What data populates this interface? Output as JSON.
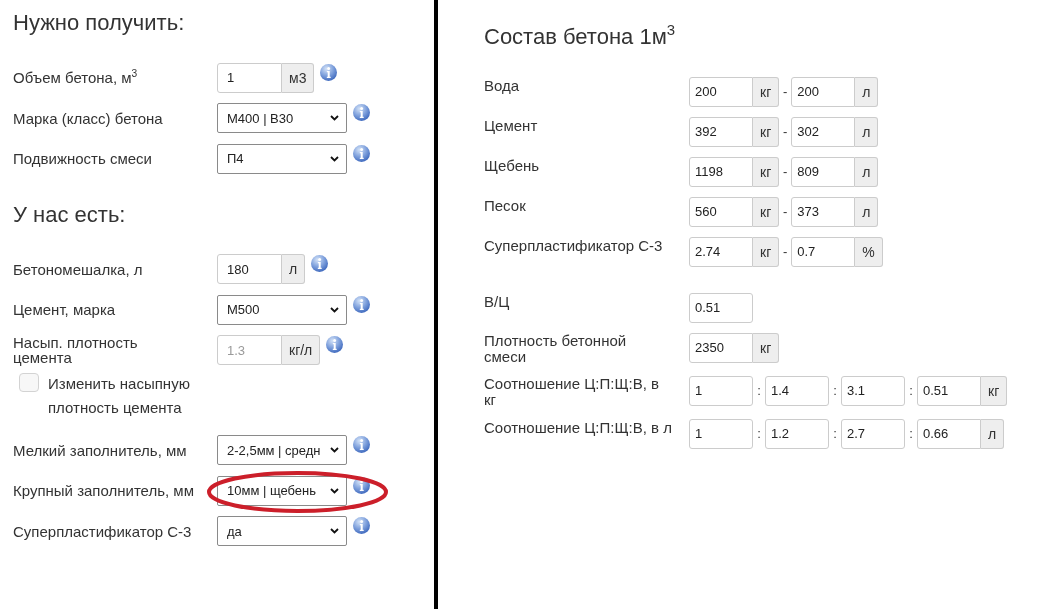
{
  "required": {
    "title": "Нужно получить:",
    "fields": [
      {
        "kind": "input",
        "label": "Объем бетона, м$^{3}$",
        "value": "1",
        "unit": "м3",
        "disabled": false,
        "highlighted": false
      },
      {
        "kind": "select",
        "label": "Марка (класс) бетона",
        "value": "М400 | В30",
        "disabled": false,
        "highlighted": false
      },
      {
        "kind": "select",
        "label": "Подвижность смеси",
        "value": "П4",
        "disabled": false,
        "highlighted": false
      }
    ]
  },
  "available": {
    "title": "У нас есть:",
    "fields": [
      {
        "kind": "input",
        "label": "Бетономешалка, л",
        "value": "180",
        "unit": "л",
        "disabled": false,
        "highlighted": false
      },
      {
        "kind": "select",
        "label": "Цемент, марка",
        "value": "М500",
        "disabled": false,
        "highlighted": false
      },
      {
        "kind": "input",
        "label": "Насып. плотность\nцемента",
        "value": "1.3",
        "unit": "кг/л",
        "disabled": true,
        "highlighted": false
      },
      {
        "kind": "checkbox",
        "label": "Изменить насыпную\nплотность цемента",
        "checked": false,
        "disabled": false,
        "highlighted": false
      },
      {
        "kind": "select",
        "label": "Мелкий заполнитель, мм",
        "value": "2-2,5мм | средн",
        "disabled": false,
        "highlighted": false
      },
      {
        "kind": "select",
        "label": "Крупный заполнитель, мм",
        "value": "10мм | щебень",
        "disabled": false,
        "highlighted": true
      },
      {
        "kind": "select",
        "label": "Суперпластификатор С-3",
        "value": "да",
        "disabled": false,
        "highlighted": false
      }
    ]
  },
  "composition": {
    "title": "Состав бетона 1м$^{3}$",
    "materials": [
      {
        "label": "Вода",
        "cells": [
          {
            "value": "200",
            "unit": "кг"
          },
          {
            "value": "200",
            "unit": "л"
          }
        ],
        "separators": [
          "-"
        ]
      },
      {
        "label": "Цемент",
        "cells": [
          {
            "value": "392",
            "unit": "кг"
          },
          {
            "value": "302",
            "unit": "л"
          }
        ],
        "separators": [
          "-"
        ]
      },
      {
        "label": "Щебень",
        "cells": [
          {
            "value": "1198",
            "unit": "кг"
          },
          {
            "value": "809",
            "unit": "л"
          }
        ],
        "separators": [
          "-"
        ]
      },
      {
        "label": "Песок",
        "cells": [
          {
            "value": "560",
            "unit": "кг"
          },
          {
            "value": "373",
            "unit": "л"
          }
        ],
        "separators": [
          "-"
        ]
      },
      {
        "label": "Суперпластификатор С-3",
        "cells": [
          {
            "value": "2.74",
            "unit": "кг"
          },
          {
            "value": "0.7",
            "unit": "%"
          }
        ],
        "separators": [
          "-"
        ]
      }
    ],
    "parameters": [
      {
        "label": "В/Ц",
        "cells": [
          {
            "value": "0.51"
          }
        ]
      },
      {
        "label": "Плотность бетонной\nсмеси",
        "cells": [
          {
            "value": "2350",
            "unit": "кг"
          }
        ]
      },
      {
        "label": "Соотношение Ц:П:Щ:В, в\nкг",
        "cells": [
          {
            "value": "1"
          },
          {
            "value": "1.4"
          },
          {
            "value": "3.1"
          },
          {
            "value": "0.51",
            "unit": "кг"
          }
        ],
        "separators": [
          ":",
          ":",
          ":"
        ]
      },
      {
        "label": "Соотношение Ц:П:Щ:В, в л",
        "cells": [
          {
            "value": "1"
          },
          {
            "value": "1.2"
          },
          {
            "value": "2.7"
          },
          {
            "value": "0.66",
            "unit": "л"
          }
        ],
        "separators": [
          ":",
          ":",
          ":"
        ]
      }
    ]
  }
}
